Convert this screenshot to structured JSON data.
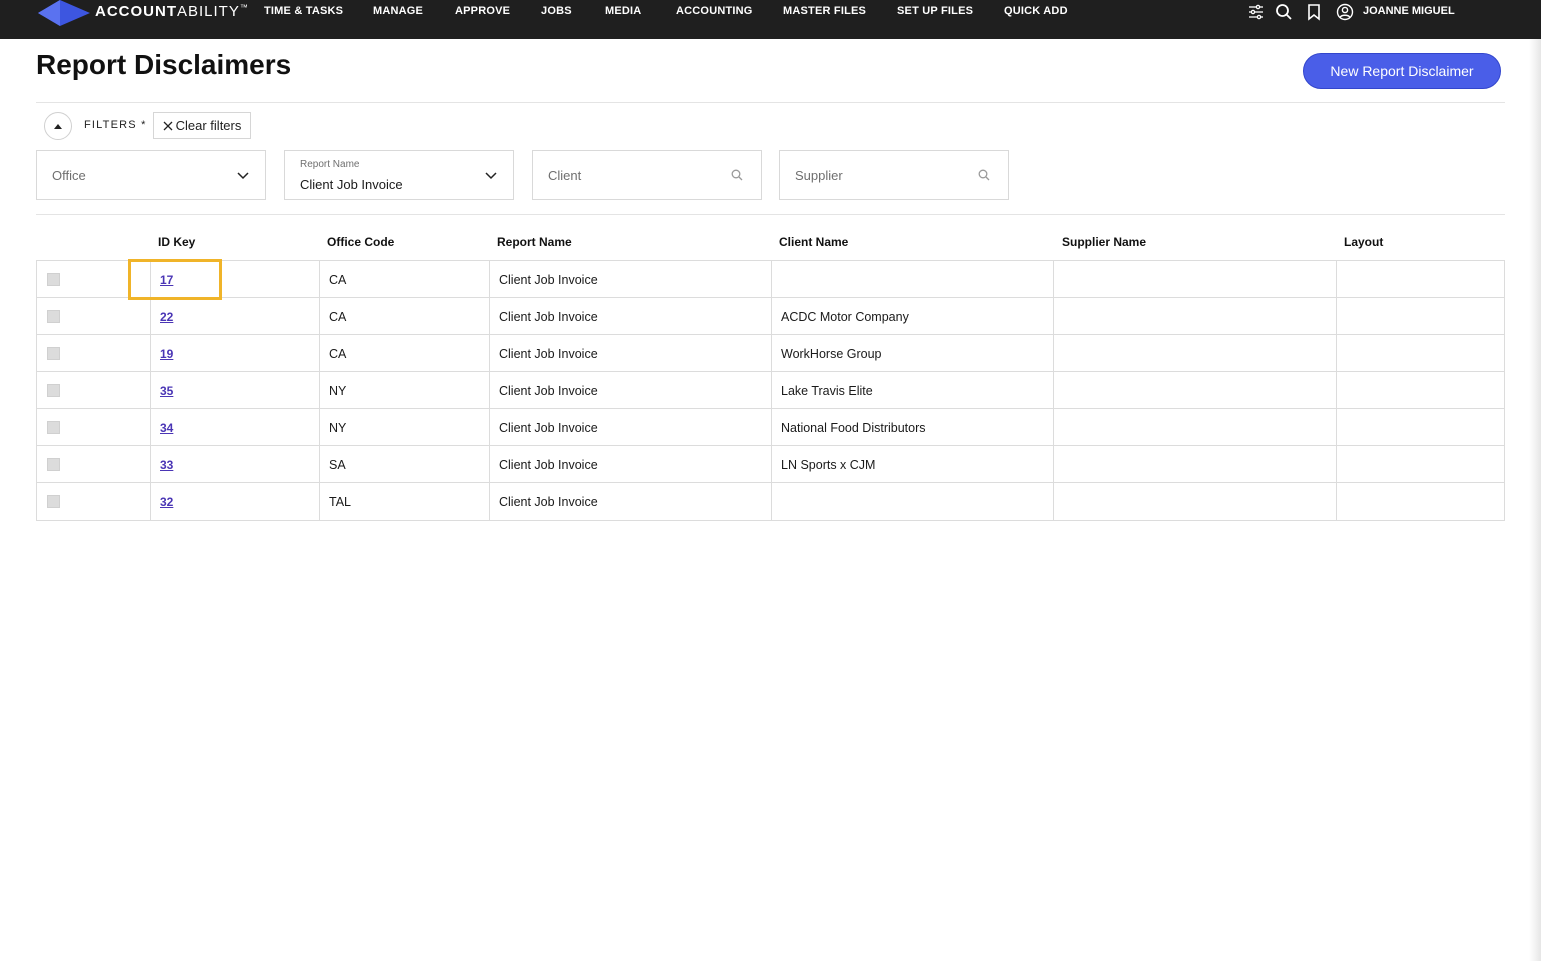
{
  "app": {
    "logo_text_bold": "ACCOUNT",
    "logo_text_light": "ABILITY",
    "logo_tm": "™",
    "brand_color": "#4a5ee8"
  },
  "nav": {
    "items": [
      {
        "label": "TIME & TASKS"
      },
      {
        "label": "MANAGE"
      },
      {
        "label": "APPROVE"
      },
      {
        "label": "JOBS"
      },
      {
        "label": "MEDIA"
      },
      {
        "label": "ACCOUNTING"
      },
      {
        "label": "MASTER FILES"
      },
      {
        "label": "SET UP FILES"
      },
      {
        "label": "QUICK ADD"
      }
    ],
    "icons": [
      "sliders-icon",
      "search-icon",
      "bookmark-icon",
      "user-circle-icon"
    ],
    "user_name": "JOANNE MIGUEL"
  },
  "page": {
    "title": "Report Disclaimers",
    "new_button_label": "New Report Disclaimer"
  },
  "filters": {
    "label": "FILTERS *",
    "clear_label": "Clear filters",
    "office": {
      "placeholder": "Office"
    },
    "report_name": {
      "label": "Report Name",
      "value": "Client Job Invoice"
    },
    "client": {
      "placeholder": "Client"
    },
    "supplier": {
      "placeholder": "Supplier"
    }
  },
  "table": {
    "headers": {
      "id_key": "ID Key",
      "office_code": "Office Code",
      "report_name": "Report Name",
      "client_name": "Client Name",
      "supplier_name": "Supplier Name",
      "layout": "Layout"
    },
    "rows": [
      {
        "id": "17",
        "office": "CA",
        "report": "Client Job Invoice",
        "client": "",
        "supplier": "",
        "layout": ""
      },
      {
        "id": "22",
        "office": "CA",
        "report": "Client Job Invoice",
        "client": "ACDC Motor Company",
        "supplier": "",
        "layout": ""
      },
      {
        "id": "19",
        "office": "CA",
        "report": "Client Job Invoice",
        "client": "WorkHorse Group",
        "supplier": "",
        "layout": ""
      },
      {
        "id": "35",
        "office": "NY",
        "report": "Client Job Invoice",
        "client": "Lake Travis Elite",
        "supplier": "",
        "layout": ""
      },
      {
        "id": "34",
        "office": "NY",
        "report": "Client Job Invoice",
        "client": "National Food Distributors",
        "supplier": "",
        "layout": ""
      },
      {
        "id": "33",
        "office": "SA",
        "report": "Client Job Invoice",
        "client": "LN Sports x CJM",
        "supplier": "",
        "layout": ""
      },
      {
        "id": "32",
        "office": "TAL",
        "report": "Client Job Invoice",
        "client": "",
        "supplier": "",
        "layout": ""
      }
    ]
  }
}
